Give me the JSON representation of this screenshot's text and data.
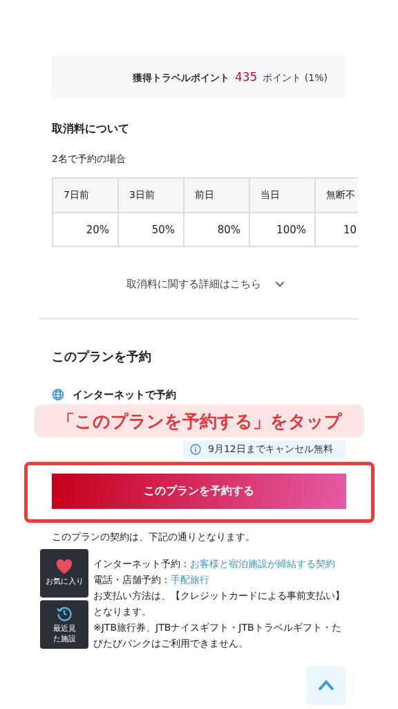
{
  "points": {
    "label": "獲得トラベルポイント",
    "value": "435",
    "unit": "ポイント (1%)"
  },
  "cancellation": {
    "title": "取消料について",
    "subtitle": "2名で予約の場合",
    "table": {
      "columns": [
        "7日前",
        "3日前",
        "前日",
        "当日",
        "無断不"
      ],
      "rows": [
        [
          "20%",
          "50%",
          "80%",
          "100%",
          "10"
        ]
      ]
    },
    "details_link": "取消料に関する詳細はこちら"
  },
  "reserve": {
    "title": "このプランを予約",
    "method": "インターネットで予約",
    "badge": "9月12日までキャンセル無料",
    "button": "このプランを予約する",
    "contract_intro": "このプランの契約は、下記の通りとなります。",
    "contract_lines": [
      {
        "label": "インターネット予約：",
        "link": "お客様と宿泊施設が締結する契約"
      },
      {
        "label": "電話・店舗予約：",
        "link": "手配旅行"
      }
    ],
    "notes": [
      "お支払い方法は、【クレジットカードによる事前支払い】となります。",
      "※JTB旅行券、JTBナイスギフト・JTBトラベルギフト・たびたびバンクはご利用できません。"
    ]
  },
  "annotation": "「このプランを予約する」をタップ",
  "floating": [
    {
      "kind": "favorite",
      "label": "お気に入り"
    },
    {
      "kind": "history",
      "label": "最近見た施設"
    }
  ]
}
